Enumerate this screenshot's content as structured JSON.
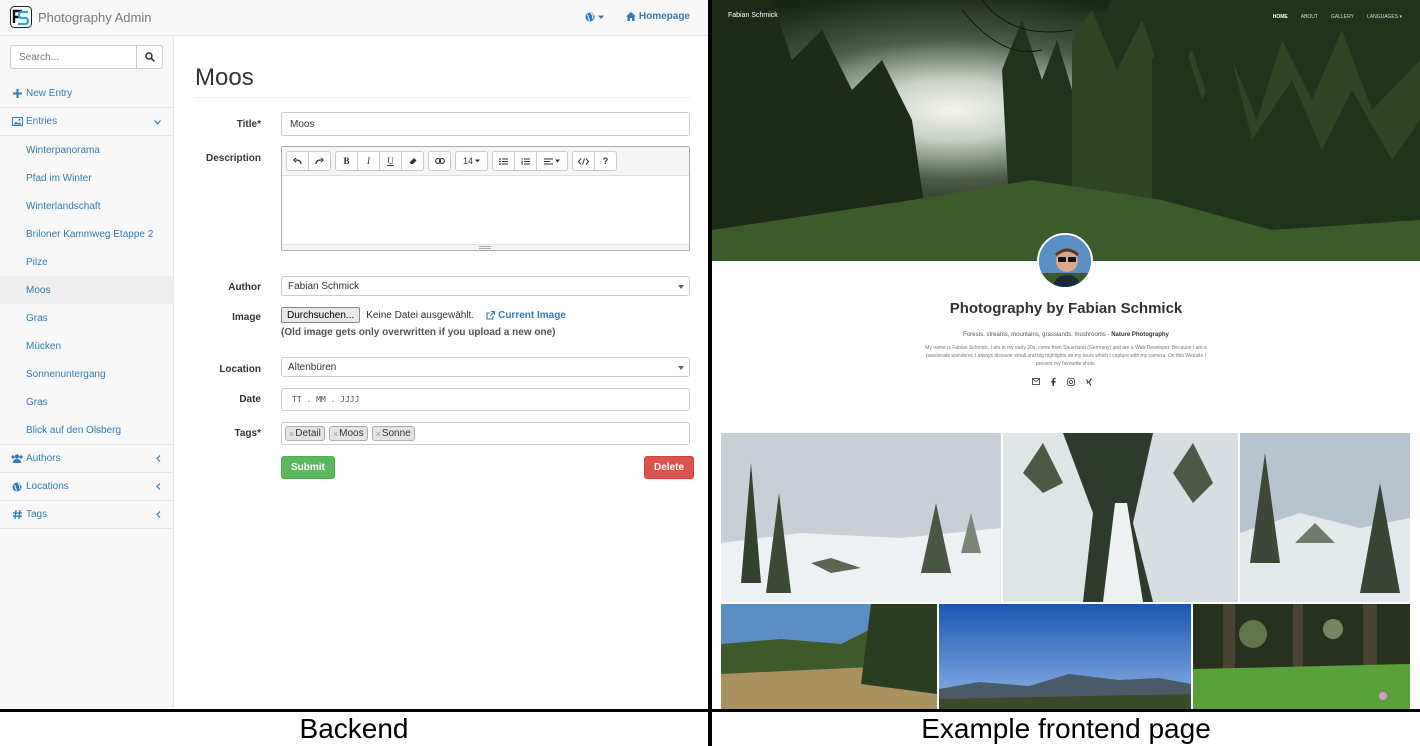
{
  "captions": {
    "left": "Backend",
    "right": "Example frontend page"
  },
  "admin": {
    "brand": "Photography Admin",
    "nav": {
      "language_icon": "globe-icon",
      "homepage_label": "Homepage"
    },
    "search": {
      "placeholder": "Search..."
    },
    "sidebar": {
      "new_entry": "New Entry",
      "entries_label": "Entries",
      "entries": [
        "Winterpanorama",
        "Pfad im Winter",
        "Winterlandschaft",
        "Briloner Kammweg Etappe 2",
        "Pilze",
        "Moos",
        "Gras",
        "Mücken",
        "Sonnenuntergang",
        "Gras",
        "Blick auf den Olsberg"
      ],
      "active_entry": "Moos",
      "authors_label": "Authors",
      "locations_label": "Locations",
      "tags_label": "Tags"
    },
    "form": {
      "page_title": "Moos",
      "title_label": "Title*",
      "title_value": "Moos",
      "description_label": "Description",
      "font_size": "14",
      "author_label": "Author",
      "author_value": "Fabian Schmick",
      "image_label": "Image",
      "file_button": "Durchsuchen...",
      "file_status": "Keine Datei ausgewählt.",
      "current_image": "Current Image",
      "image_help": "(Old image gets only overwritten if you upload a new one)",
      "location_label": "Location",
      "location_value": "Altenbüren",
      "date_label": "Date",
      "date_placeholder": "TT . MM . JJJJ",
      "tags_label": "Tags*",
      "tags": [
        "Detail",
        "Moos",
        "Sonne"
      ],
      "submit": "Submit",
      "delete": "Delete"
    }
  },
  "frontend": {
    "brand": "Fabian Schmick",
    "menu": {
      "home": "HOME",
      "about": "ABOUT",
      "gallery": "GALLERY",
      "languages": "LANGUAGES ▾"
    },
    "title": "Photography by Fabian Schmick",
    "subtitle": "Forests, streams, mountains, grasslands, mushrooms - ",
    "subtitle_bold": "Nature Photography",
    "about": "My name is Fabian Schmick, I am in my early 20s, come from Sauerland (Germany) and are a Web Developer. Because I am a passionate wanderer, I always discover small and big highlights on my tours which I capture with my camera. On this Website I present my favourite shots.",
    "social_icons": [
      "mail-icon",
      "facebook-icon",
      "instagram-icon",
      "xing-icon"
    ]
  }
}
